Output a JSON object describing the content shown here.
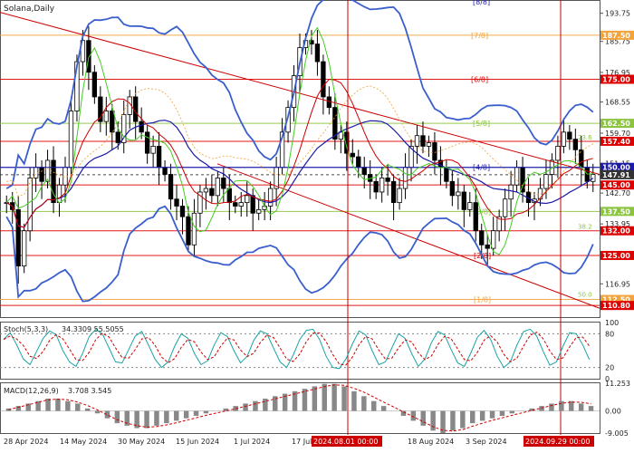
{
  "chart_data": {
    "type": "line",
    "title": "Solana,Daily",
    "ylim": [
      107.5,
      197.5
    ],
    "y_ticks": [
      193.75,
      185.75,
      176.95,
      168.55,
      159.7,
      151.15,
      142.7,
      133.95,
      125.4,
      116.95
    ],
    "x_tick_labels": [
      "28 Apr 2024",
      "14 May 2024",
      "30 May 2024",
      "15 Jun 2024",
      "1 Jul 2024",
      "17 Jul",
      "2024.08.01 00:00",
      "18 Aug 2024",
      "3 Sep 2024",
      "2024.09.29 00:00"
    ],
    "highlighted_dates": [
      "2024.08.01 00:00",
      "2024.09.29 00:00"
    ],
    "price_levels": [
      {
        "label": "187.50",
        "value": 187.5,
        "color": "#f2a33a"
      },
      {
        "label": "175.00",
        "value": 175.0,
        "color": "#dd0000"
      },
      {
        "label": "162.50",
        "value": 162.5,
        "color": "#8bc53f"
      },
      {
        "label": "157.40",
        "value": 157.4,
        "color": "#dd0000"
      },
      {
        "label": "150.00",
        "value": 150.0,
        "color": "#1a1aa6"
      },
      {
        "label": "147.91",
        "value": 147.91,
        "color": "#333333"
      },
      {
        "label": "145.00",
        "value": 145.0,
        "color": "#dd0000"
      },
      {
        "label": "137.50",
        "value": 137.5,
        "color": "#8bc53f"
      },
      {
        "label": "132.00",
        "value": 132.0,
        "color": "#dd0000"
      },
      {
        "label": "125.00",
        "value": 125.0,
        "color": "#dd0000"
      },
      {
        "label": "112.50",
        "value": 112.5,
        "color": "#f2a33a"
      },
      {
        "label": "110.80",
        "value": 110.8,
        "color": "#dd0000"
      }
    ],
    "murrey_labels": [
      "[8/8]",
      "[7/8]",
      "[6/8]",
      "[5/8]",
      "[4/8]",
      "[3/8]",
      "[2/8]",
      "[1/8]"
    ],
    "fib_labels": [
      "23.6",
      "38.2",
      "50.0"
    ],
    "close_series": [
      140,
      138,
      122,
      132,
      147,
      150,
      146,
      152,
      140,
      145,
      150,
      166,
      180,
      186,
      177,
      170,
      163,
      166,
      160,
      157,
      165,
      170,
      163,
      160,
      154,
      156,
      150,
      148,
      141,
      139,
      136,
      128,
      137,
      143,
      144,
      142,
      147,
      144,
      140,
      139,
      140,
      142,
      137,
      138,
      139,
      144,
      150,
      160,
      167,
      176,
      184,
      186,
      185,
      180,
      170,
      167,
      158,
      160,
      154,
      153,
      150,
      148,
      146,
      143,
      147,
      146,
      140,
      144,
      150,
      156,
      159,
      156,
      157,
      152,
      150,
      146,
      142,
      143,
      138,
      140,
      132,
      128,
      127,
      132,
      136,
      141,
      145,
      150,
      143,
      140,
      141,
      144,
      148,
      152,
      156,
      160,
      158,
      155,
      150,
      146,
      148
    ],
    "stochastic": {
      "label": "Stoch(5,3,3)",
      "values_label": "34.3309 55.5055",
      "k": 34.3309,
      "d": 55.5055,
      "levels": [
        100,
        80,
        20,
        0
      ],
      "k_series": [
        70,
        82,
        60,
        35,
        25,
        48,
        72,
        85,
        78,
        50,
        30,
        22,
        45,
        75,
        88,
        80,
        55,
        30,
        28,
        52,
        76,
        84,
        60,
        35,
        20,
        30,
        58,
        80,
        72,
        45,
        25,
        32,
        60,
        82,
        75,
        50,
        28,
        40,
        68,
        85,
        80,
        55,
        30,
        20,
        42,
        70,
        86,
        88,
        70,
        40,
        20,
        18,
        35,
        62,
        85,
        78,
        50,
        25,
        30,
        55,
        80,
        72,
        45,
        22,
        35,
        64,
        84,
        78,
        52,
        28,
        22,
        46,
        74,
        86,
        70,
        40,
        20,
        30,
        60,
        84,
        88,
        76,
        48,
        24,
        30,
        58,
        82,
        80,
        60,
        34
      ]
    },
    "macd": {
      "label": "MACD(12,26,9)",
      "values_label": "3.708 3.545",
      "macd": 3.708,
      "signal": 3.545,
      "scale_labels": [
        "11.253",
        "0.00",
        "-9.005"
      ],
      "hist_series": [
        1,
        2,
        3,
        4,
        5,
        5,
        4,
        3,
        1,
        -1,
        -3,
        -5,
        -6,
        -7,
        -7,
        -6,
        -5,
        -4,
        -3,
        -2,
        -1,
        0,
        1,
        2,
        3,
        4,
        5,
        6,
        7,
        8,
        9,
        10,
        11,
        11,
        10,
        8,
        6,
        4,
        2,
        0,
        -2,
        -4,
        -6,
        -8,
        -9,
        -8,
        -7,
        -5,
        -4,
        -3,
        -2,
        -1,
        0,
        1,
        2,
        3,
        4,
        4,
        3,
        2
      ],
      "signal_series": [
        0.5,
        1.5,
        2.5,
        3.5,
        4.5,
        4.8,
        4.5,
        3.6,
        2.2,
        0.4,
        -1.6,
        -3.6,
        -5.0,
        -6.0,
        -6.6,
        -6.4,
        -5.7,
        -4.8,
        -3.8,
        -2.8,
        -1.8,
        -0.9,
        0.0,
        0.9,
        1.9,
        2.9,
        3.9,
        4.9,
        5.9,
        6.9,
        7.9,
        8.9,
        9.9,
        10.6,
        10.4,
        9.2,
        7.6,
        5.6,
        3.6,
        1.6,
        -0.4,
        -2.4,
        -4.4,
        -6.4,
        -7.9,
        -8.2,
        -7.6,
        -6.2,
        -5.0,
        -3.8,
        -2.8,
        -1.8,
        -0.8,
        0.2,
        1.2,
        2.2,
        3.1,
        3.6,
        3.5,
        2.9
      ]
    }
  }
}
